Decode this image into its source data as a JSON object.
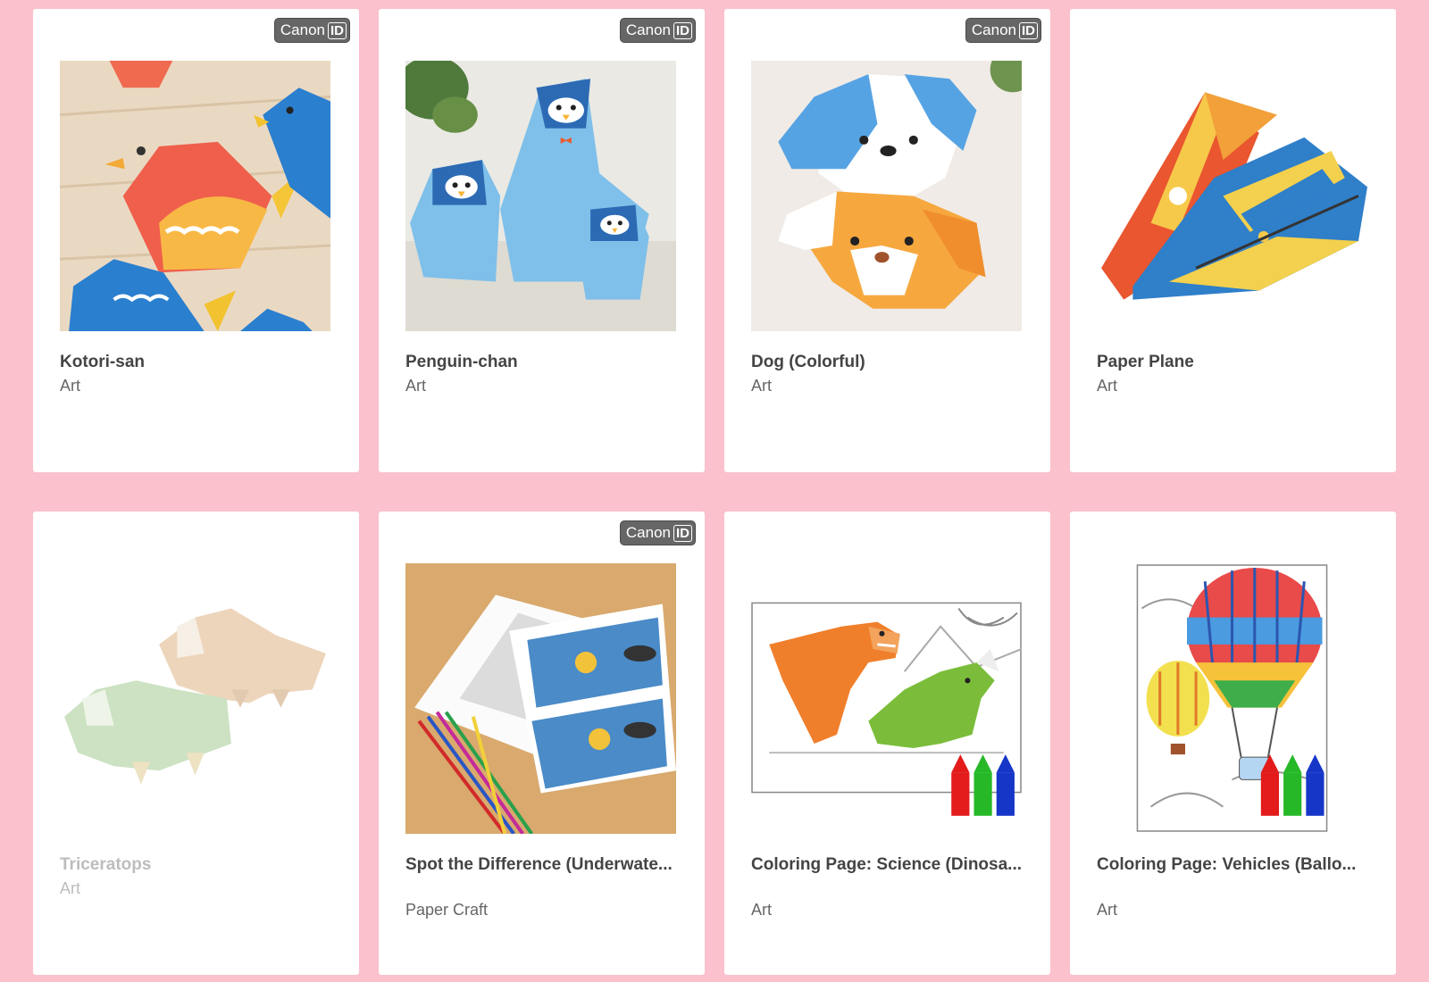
{
  "badge": {
    "brand": "Canon",
    "suffix": "ID"
  },
  "cards": [
    {
      "title": "Kotori-san",
      "category": "Art"
    },
    {
      "title": "Penguin-chan",
      "category": "Art"
    },
    {
      "title": "Dog (Colorful)",
      "category": "Art"
    },
    {
      "title": "Paper Plane",
      "category": "Art"
    },
    {
      "title": "Triceratops",
      "category": "Art"
    },
    {
      "title": "Spot the Difference (Underwate...",
      "category": "Paper Craft"
    },
    {
      "title": "Coloring Page: Science (Dinosa...",
      "category": "Art"
    },
    {
      "title": "Coloring Page: Vehicles (Ballo...",
      "category": "Art"
    }
  ],
  "colors": {
    "background": "#fbc1cd",
    "badge": "#666666"
  }
}
